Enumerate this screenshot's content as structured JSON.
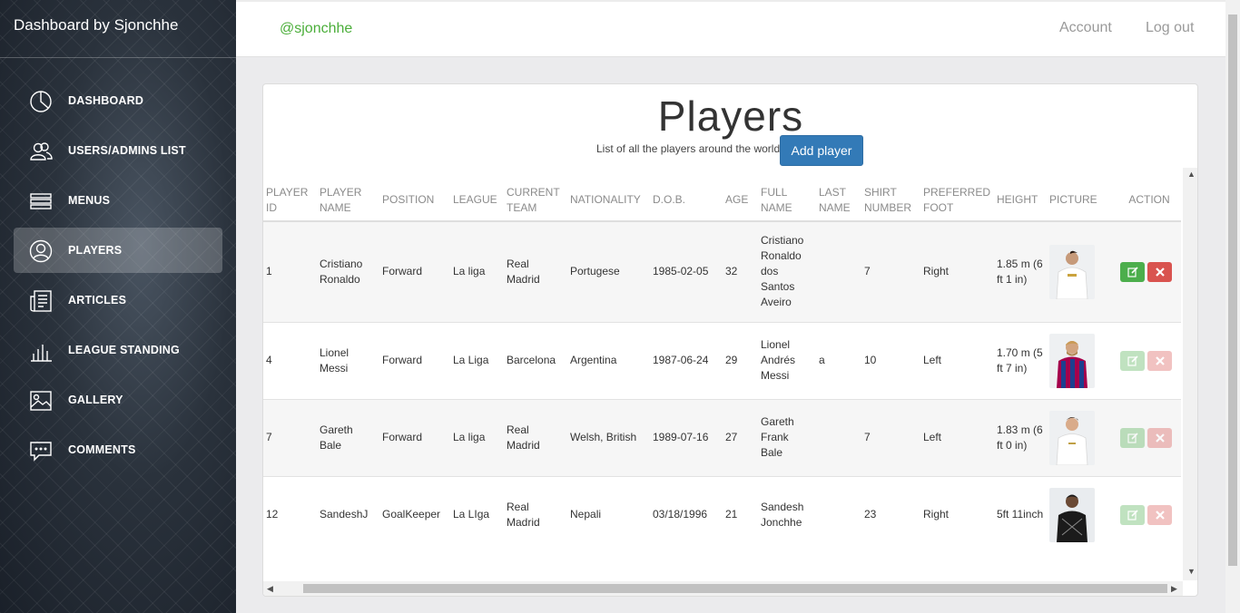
{
  "sidebar": {
    "brand": "Dashboard by Sjonchhe",
    "items": [
      {
        "label": "DASHBOARD",
        "icon": "pie-chart-icon"
      },
      {
        "label": "USERS/ADMINS LIST",
        "icon": "users-icon"
      },
      {
        "label": "MENUS",
        "icon": "menu-lines-icon"
      },
      {
        "label": "PLAYERS",
        "icon": "user-circle-icon",
        "active": true
      },
      {
        "label": "ARTICLES",
        "icon": "newspaper-icon"
      },
      {
        "label": "LEAGUE STANDING",
        "icon": "bar-chart-icon"
      },
      {
        "label": "GALLERY",
        "icon": "image-icon"
      },
      {
        "label": "COMMENTS",
        "icon": "comment-icon"
      }
    ]
  },
  "topbar": {
    "handle": "@sjonchhe",
    "account": "Account",
    "logout": "Log out"
  },
  "players": {
    "title": "Players",
    "subtitle": "List of all the players around the world",
    "add_button": "Add player",
    "columns": [
      "PLAYER ID",
      "PLAYER NAME",
      "POSITION",
      "LEAGUE",
      "CURRENT TEAM",
      "NATIONALITY",
      "D.O.B.",
      "AGE",
      "FULL NAME",
      "LAST NAME",
      "SHIRT NUMBER",
      "PREFERRED FOOT",
      "HEIGHT",
      "PICTURE",
      "ACTION"
    ],
    "rows": [
      {
        "id": "1",
        "name": "Cristiano Ronaldo",
        "position": "Forward",
        "league": "La liga",
        "team": "Real Madrid",
        "nationality": "Portugese",
        "dob": "1985-02-05",
        "age": "32",
        "full_name": "Cristiano Ronaldo dos Santos Aveiro",
        "last_name": "",
        "shirt": "7",
        "foot": "Right",
        "height": "1.85 m (6 ft 1 in)",
        "picture": "player-photo-white-kit",
        "actions_enabled": true
      },
      {
        "id": "4",
        "name": "Lionel Messi",
        "position": "Forward",
        "league": "La Liga",
        "team": "Barcelona",
        "nationality": "Argentina",
        "dob": "1987-06-24",
        "age": "29",
        "full_name": "Lionel Andrés Messi",
        "last_name": "a",
        "shirt": "10",
        "foot": "Left",
        "height": "1.70 m (5 ft 7 in)",
        "picture": "player-photo-striped-kit",
        "actions_enabled": false
      },
      {
        "id": "7",
        "name": "Gareth Bale",
        "position": "Forward",
        "league": "La liga",
        "team": "Real Madrid",
        "nationality": "Welsh, British",
        "dob": "1989-07-16",
        "age": "27",
        "full_name": "Gareth Frank Bale",
        "last_name": "",
        "shirt": "7",
        "foot": "Left",
        "height": "1.83 m (6 ft 0 in)",
        "picture": "player-photo-white-kit",
        "actions_enabled": false
      },
      {
        "id": "12",
        "name": "SandeshJ",
        "position": "GoalKeeper",
        "league": "La LIga",
        "team": "Real Madrid",
        "nationality": "Nepali",
        "dob": "03/18/1996",
        "age": "21",
        "full_name": "Sandesh Jonchhe",
        "last_name": "",
        "shirt": "23",
        "foot": "Right",
        "height": "5ft 11inch",
        "picture": "player-photo-dark-kit",
        "actions_enabled": false
      }
    ]
  },
  "colors": {
    "accent_green": "#4bae3a",
    "primary_blue": "#337ab7",
    "edit_green": "#4cae4c",
    "delete_red": "#d9534f"
  }
}
